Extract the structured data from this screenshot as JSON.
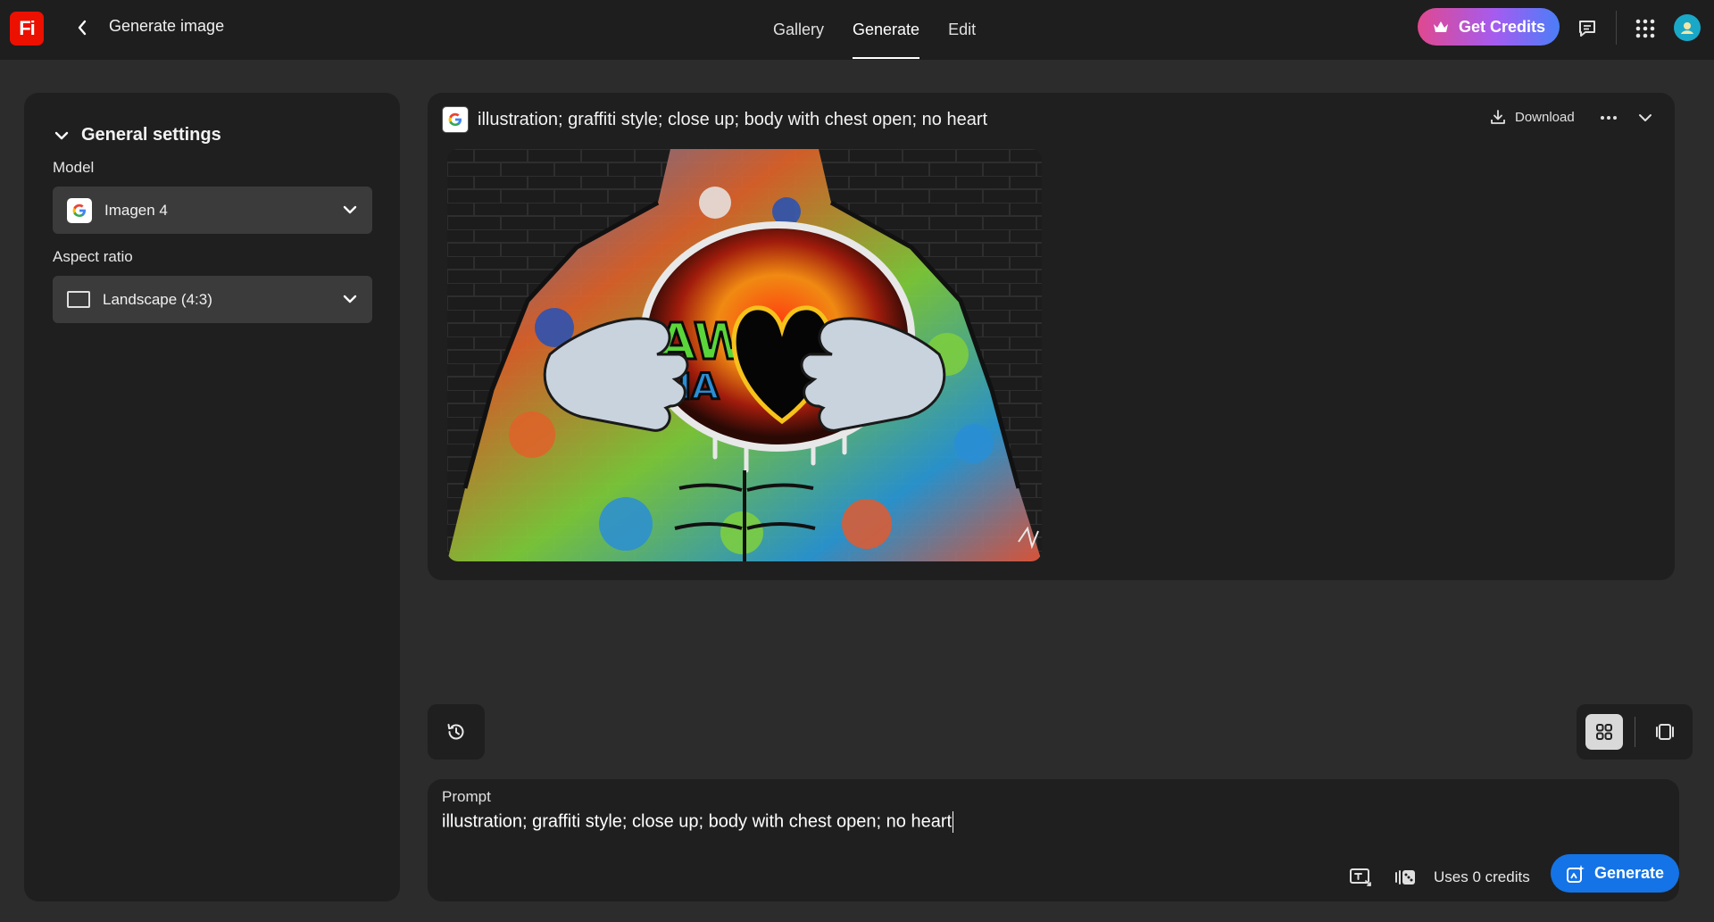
{
  "app": {
    "logo_text": "Fi",
    "title": "Generate image"
  },
  "nav": {
    "tabs": [
      {
        "label": "Gallery",
        "active": false
      },
      {
        "label": "Generate",
        "active": true
      },
      {
        "label": "Edit",
        "active": false
      }
    ]
  },
  "header": {
    "credits_label": "Get Credits",
    "icons": [
      "crown-icon",
      "feedback-icon",
      "apps-grid-icon",
      "avatar"
    ]
  },
  "settings": {
    "section_title": "General settings",
    "model_label": "Model",
    "model_value": "Imagen 4",
    "aspect_label": "Aspect ratio",
    "aspect_value": "Landscape (4:3)"
  },
  "result": {
    "prompt_title": "illustration; graffiti style; close up; body with chest open; no heart",
    "download_label": "Download"
  },
  "prompt_panel": {
    "label": "Prompt",
    "value": "illustration; graffiti style; close up; body with chest open; no heart",
    "credits_text": "Uses 0 credits",
    "generate_label": "Generate"
  },
  "colors": {
    "background": "#2c2c2c",
    "panel": "#1f1f1f",
    "topbar": "#1e1e1e",
    "accent_blue": "#1473e6",
    "logo_red": "#eb1000",
    "credits_gradient": [
      "#e0488f",
      "#a45cf0",
      "#4b7ef8"
    ]
  }
}
